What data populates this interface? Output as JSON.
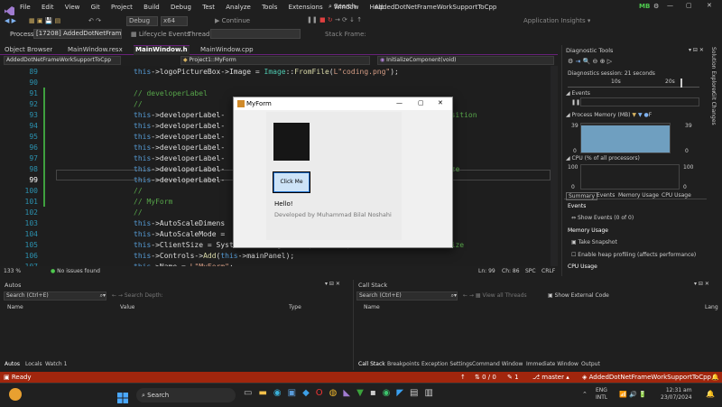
{
  "titlebar": {
    "menus": [
      "File",
      "Edit",
      "View",
      "Git",
      "Project",
      "Build",
      "Debug",
      "Test",
      "Analyze",
      "Tools",
      "Extensions",
      "Window",
      "Help"
    ],
    "search": "Search",
    "solution": "AddedDotNetFrameWorkSupportToCpp",
    "avatar": "MB"
  },
  "toolbar": {
    "config": "Debug",
    "platform": "x64",
    "continue": "Continue",
    "app_insights": "Application Insights"
  },
  "processbar": {
    "process_label": "Process:",
    "process": "[17208] AddedDotNetFrameWorkSupportToCpp.e",
    "lifecycle": "Lifecycle Events",
    "thread": "Thread:",
    "stack_frame": "Stack Frame:"
  },
  "doc_tabs": [
    {
      "label": "Object Browser"
    },
    {
      "label": "MainWindow.resx"
    },
    {
      "label": "MainWindow.h",
      "active": true
    },
    {
      "label": "MainWindow.cpp"
    }
  ],
  "nav": {
    "project": "AddedDotNetFrameWorkSupportToCpp",
    "scope": "Project1::MyForm",
    "member": "InitializeComponent(void)"
  },
  "editor": {
    "line_numbers": [
      "89",
      "90",
      "91",
      "92",
      "93",
      "94",
      "95",
      "96",
      "97",
      "98",
      "99",
      "100",
      "101",
      "102",
      "103",
      "104",
      "105",
      "106",
      "107"
    ],
    "lines": [
      [
        [
          "k",
          "this"
        ],
        [
          "p",
          "->"
        ],
        [
          "v",
          "logoPictureBox"
        ],
        [
          "p",
          "->Image = "
        ],
        [
          "t",
          "Image"
        ],
        [
          "p",
          "::"
        ],
        [
          "f",
          "FromFile"
        ],
        [
          "p",
          "("
        ],
        [
          "s",
          "L\"coding.png\""
        ],
        [
          "p",
          ");"
        ]
      ],
      [],
      [
        [
          "c",
          "// developerLabel"
        ]
      ],
      [
        [
          "c",
          "//"
        ]
      ],
      [
        [
          "k",
          "this"
        ],
        [
          "p",
          "->developerLabel-"
        ],
        [
          "x",
          "                                      "
        ],
        [
          "c",
          "// Adjusted position"
        ]
      ],
      [
        [
          "k",
          "this"
        ],
        [
          "p",
          "->developerLabel-"
        ]
      ],
      [
        [
          "k",
          "this"
        ],
        [
          "p",
          "->developerLabel-"
        ],
        [
          "x",
          "                                   "
        ],
        [
          "c",
          "justed size"
        ]
      ],
      [
        [
          "k",
          "this"
        ],
        [
          "p",
          "->developerLabel-"
        ]
      ],
      [
        [
          "k",
          "this"
        ],
        [
          "p",
          "->developerLabel-"
        ],
        [
          "x",
          "                                    "
        ],
        [
          "p",
          ";"
        ]
      ],
      [
        [
          "k",
          "this"
        ],
        [
          "p",
          "->developerLabel-"
        ],
        [
          "x",
          "                                   "
        ],
        [
          "n",
          "10"
        ],
        [
          "p",
          ")); "
        ],
        [
          "c",
          " // Font size"
        ]
      ],
      [
        [
          "k",
          "this"
        ],
        [
          "p",
          "->developerLabel-"
        ],
        [
          "x",
          "                                    "
        ],
        [
          "c",
          "Optional color"
        ]
      ],
      [
        [
          "c",
          "//"
        ]
      ],
      [
        [
          "c",
          "// MyForm"
        ]
      ],
      [
        [
          "c",
          "//"
        ]
      ],
      [
        [
          "k",
          "this"
        ],
        [
          "p",
          "->AutoScaleDimens"
        ]
      ],
      [
        [
          "k",
          "this"
        ],
        [
          "p",
          "->AutoScaleMode ="
        ]
      ],
      [
        [
          "k",
          "this"
        ],
        [
          "p",
          "->ClientSize = System::Drawing::"
        ],
        [
          "t",
          "Size"
        ],
        [
          "p",
          "("
        ],
        [
          "n",
          "484"
        ],
        [
          "p",
          ", "
        ],
        [
          "n",
          "361"
        ],
        [
          "p",
          ");  "
        ],
        [
          "c",
          "// Increased ClientSize"
        ]
      ],
      [
        [
          "k",
          "this"
        ],
        [
          "p",
          "->Controls->"
        ],
        [
          "f",
          "Add"
        ],
        [
          "p",
          "("
        ],
        [
          "k",
          "this"
        ],
        [
          "p",
          "->mainPanel);"
        ]
      ],
      [
        [
          "k",
          "this"
        ],
        [
          "p",
          "->Name = "
        ],
        [
          "s",
          "L\"MyForm\""
        ],
        [
          "p",
          ";"
        ]
      ]
    ],
    "status": {
      "zoom": "133 %",
      "issues": "No issues found",
      "ln": "Ln: 99",
      "ch": "Ch: 86",
      "spc": "SPC",
      "crlf": "CRLF"
    }
  },
  "myform": {
    "title": "MyForm",
    "button": "Click Me",
    "hello": "Hello!",
    "developer": "Developed by Muhammad Bilal Noshahi"
  },
  "diag": {
    "title": "Diagnostic Tools",
    "session": "Diagnostics session: 21 seconds",
    "t1": "10s",
    "t2": "20s",
    "events": "Events",
    "process_memory": "Process Memory (MB)",
    "legend": "F",
    "mem_max": "39",
    "mem_min": "0",
    "cpu": "CPU (% of all processors)",
    "cpu_max": "100",
    "cpu_min": "0",
    "tabs": [
      "Summary",
      "Events",
      "Memory Usage",
      "CPU Usage"
    ],
    "sec_events": "Events",
    "show_events": "Show Events (0 of 0)",
    "sec_memory": "Memory Usage",
    "take_snapshot": "Take Snapshot",
    "heap": "Enable heap profiling (affects performance)",
    "sec_cpu": "CPU Usage"
  },
  "side_tabs": [
    "Solution Explorer",
    "Git Changes"
  ],
  "autos": {
    "title": "Autos",
    "search": "Search (Ctrl+E)",
    "depth": "Search Depth:",
    "cols": [
      "Name",
      "Value",
      "Type"
    ],
    "tabs": [
      "Autos",
      "Locals",
      "Watch 1"
    ]
  },
  "callstack": {
    "title": "Call Stack",
    "search": "Search (Ctrl+E)",
    "view_threads": "View all Threads",
    "external": "Show External Code",
    "cols": [
      "Name",
      "Lang"
    ],
    "tabs": [
      "Call Stack",
      "Breakpoints",
      "Exception Settings",
      "Command Window",
      "Immediate Window",
      "Output"
    ]
  },
  "statusbar": {
    "ready": "Ready",
    "errors": "0 / 0",
    "pencil": "1",
    "branch": "master",
    "repo": "AddedDotNetFrameWorkSupportToCpp"
  },
  "taskbar": {
    "search": "Search",
    "lang1": "ENG",
    "lang2": "INTL",
    "time": "12:31 am",
    "date": "23/07/2024"
  },
  "colors": {
    "accent": "#68217a",
    "status": "#a1260d",
    "taskbar": "#202020"
  }
}
